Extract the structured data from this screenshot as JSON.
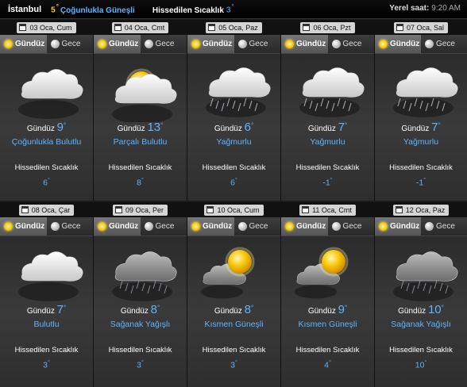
{
  "header": {
    "city": "İstanbul",
    "current_temp": "5",
    "current_condition": "Çoğunlukla Güneşli",
    "feels_label": "Hissedilen Sıcaklık",
    "feels_value": "3",
    "local_time_label": "Yerel saat:",
    "local_time": "9:20 AM"
  },
  "tabs": {
    "day": "Gündüz",
    "night": "Gece"
  },
  "labels": {
    "day_prefix": "Gündüz",
    "feels": "Hissedilen Sıcaklık",
    "degree": "°"
  },
  "days": [
    {
      "date": "03 Oca, Cum",
      "icon": "cloud-icon",
      "temp": "9",
      "condition": "Çoğunlukla Bulutlu",
      "feels": "6"
    },
    {
      "date": "04 Oca, Cmt",
      "icon": "sun-behind-cloud-icon",
      "temp": "13",
      "condition": "Parçalı Bulutlu",
      "feels": "8"
    },
    {
      "date": "05 Oca, Paz",
      "icon": "rain-cloud-icon",
      "temp": "6",
      "condition": "Yağmurlu",
      "feels": "6"
    },
    {
      "date": "06 Oca, Pzt",
      "icon": "rain-cloud-icon",
      "temp": "7",
      "condition": "Yağmurlu",
      "feels": "-1"
    },
    {
      "date": "07 Oca, Sal",
      "icon": "rain-cloud-icon",
      "temp": "7",
      "condition": "Yağmurlu",
      "feels": "-1"
    },
    {
      "date": "08 Oca, Çar",
      "icon": "cloud-icon",
      "temp": "7",
      "condition": "Bulutlu",
      "feels": "3"
    },
    {
      "date": "09 Oca, Per",
      "icon": "shower-cloud-icon",
      "temp": "8",
      "condition": "Sağanak Yağışlı",
      "feels": "3"
    },
    {
      "date": "10 Oca, Cum",
      "icon": "sun-with-cloud-icon",
      "temp": "8",
      "condition": "Kısmen Güneşli",
      "feels": "3"
    },
    {
      "date": "11 Oca, Cmt",
      "icon": "sun-with-cloud-icon",
      "temp": "9",
      "condition": "Kısmen Güneşli",
      "feels": "4"
    },
    {
      "date": "12 Oca, Paz",
      "icon": "shower-cloud-icon",
      "temp": "10",
      "condition": "Sağanak Yağışlı",
      "feels": "10"
    }
  ],
  "colors": {
    "accent_blue": "#5fb4ff",
    "accent_yellow": "#ffcd3a"
  }
}
